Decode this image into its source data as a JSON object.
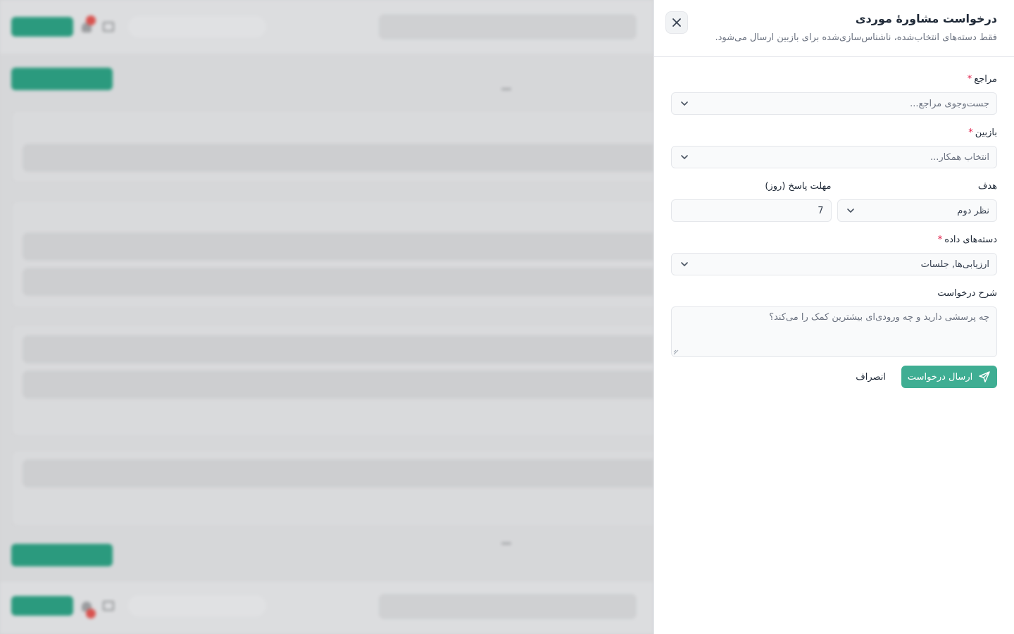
{
  "drawer": {
    "title": "درخواست مشاورهٔ موردی",
    "subtitle": "فقط دسته‌های انتخاب‌شده، ناشناس‌سازی‌شده برای بازبین ارسال می‌شود."
  },
  "form": {
    "client": {
      "label": "مراجع",
      "required": "*",
      "placeholder": "جست‌وجوی مراجع..."
    },
    "reviewer": {
      "label": "بازبین",
      "required": "*",
      "placeholder": "انتخاب همکار..."
    },
    "goal": {
      "label": "هدف",
      "value": "نظر دوم"
    },
    "deadline": {
      "label": "مهلت پاسخ (روز)",
      "value": "7"
    },
    "datasets": {
      "label": "دسته‌های داده",
      "required": "*",
      "value": "ارزیابی‌ها, جلسات"
    },
    "description": {
      "label": "شرح درخواست",
      "placeholder": "چه پرسشی دارید و چه ورودی‌ای بیشترین کمک را می‌کند؟"
    }
  },
  "actions": {
    "submit_label": "ارسال درخواست",
    "cancel_label": "انصراف"
  },
  "colors": {
    "accent": "#3fae93",
    "required": "#e11d48"
  }
}
